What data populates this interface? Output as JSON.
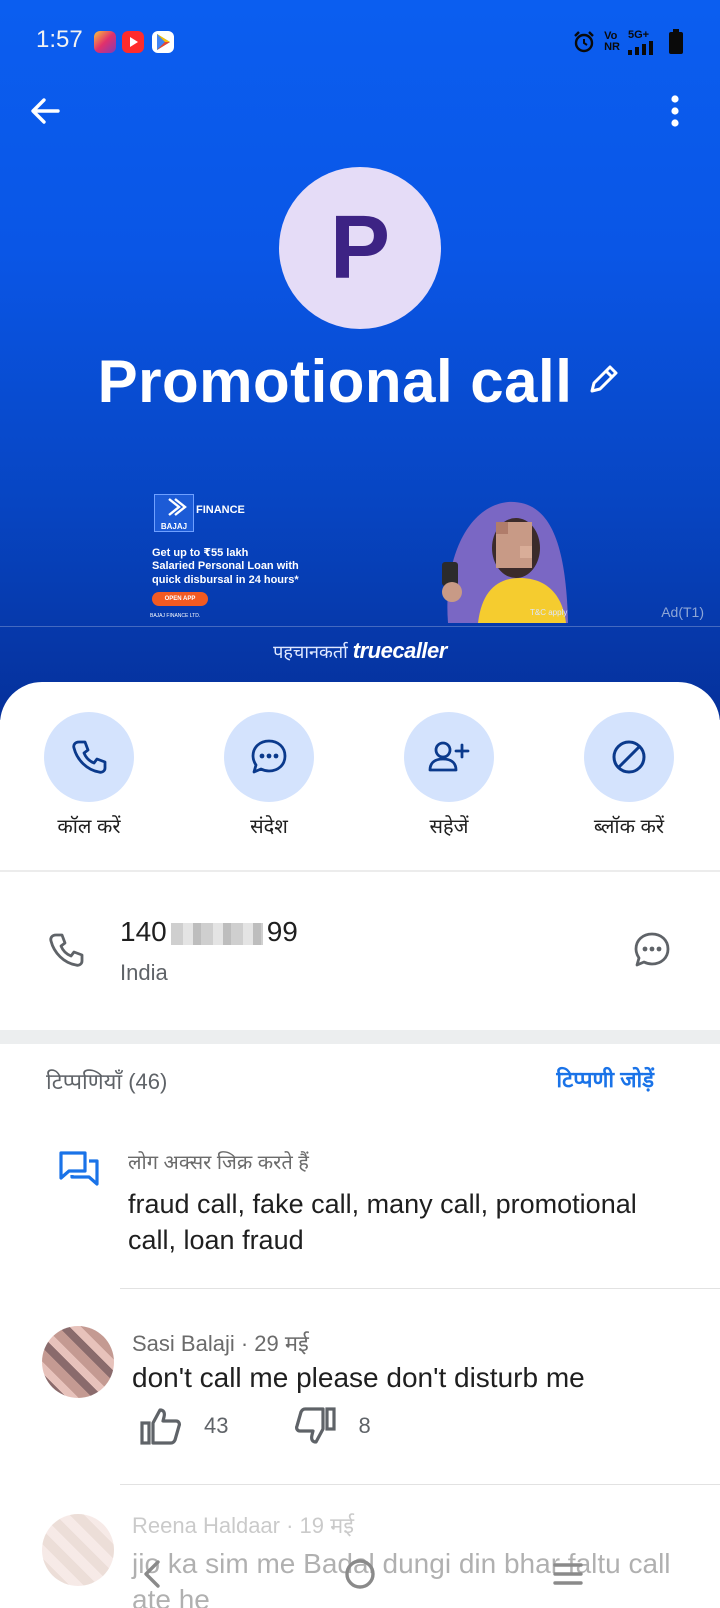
{
  "status_bar": {
    "time": "1:57",
    "network_labels": [
      "Vo",
      "NR",
      "5G+"
    ],
    "icons": [
      "instagram-icon",
      "youtube-icon",
      "play-store-icon",
      "alarm-icon",
      "signal-icon",
      "battery-icon"
    ]
  },
  "header": {
    "back_icon": "arrow-left-icon",
    "menu_icon": "more-vertical-icon"
  },
  "contact": {
    "avatar_letter": "P",
    "name": "Promotional call",
    "edit_icon": "pencil-icon"
  },
  "ad": {
    "brand_badge": "BAJAJ",
    "brand": "FINANCE",
    "line1": "Get up to ₹55 lakh",
    "line2": "Salaried Personal Loan with",
    "line3": "quick disbursal in 24 hours*",
    "cta": "OPEN APP",
    "fineprint": "BAJAJ FINANCE LTD.",
    "tc": "T&C apply",
    "tag": "Ad(T1)"
  },
  "identified_by": {
    "prefix": "पहचानकर्ता",
    "brand": "truecaller"
  },
  "actions": [
    {
      "label": "कॉल करें",
      "icon": "phone-icon"
    },
    {
      "label": "संदेश",
      "icon": "message-icon"
    },
    {
      "label": "सहेजें",
      "icon": "add-contact-icon"
    },
    {
      "label": "ब्लॉक करें",
      "icon": "block-icon"
    }
  ],
  "number": {
    "prefix": "140",
    "suffix": "99",
    "country": "India"
  },
  "comments": {
    "title": "टिप्पणियाँ (46)",
    "add_label": "टिप्पणी जोड़ें",
    "mentions_label": "लोग अक्सर जिक्र करते हैं",
    "mentions": "fraud call, fake call, many call, promotional call, loan fraud",
    "items": [
      {
        "author": "Sasi Balaji",
        "date": "29 मई",
        "text": "don't call me please  don't disturb me",
        "likes": "43",
        "dislikes": "8"
      },
      {
        "author": "Reena Haldaar",
        "date": "19 मई",
        "text": "jio ka sim me Badal dungi din bhar faltu call ate he"
      }
    ]
  },
  "colors": {
    "hero_blue": "#0b5ef0",
    "accent": "#1a73e8",
    "action_bg": "#d4e3fd",
    "avatar_bg": "#e5dcf7",
    "avatar_text": "#3d2384"
  }
}
